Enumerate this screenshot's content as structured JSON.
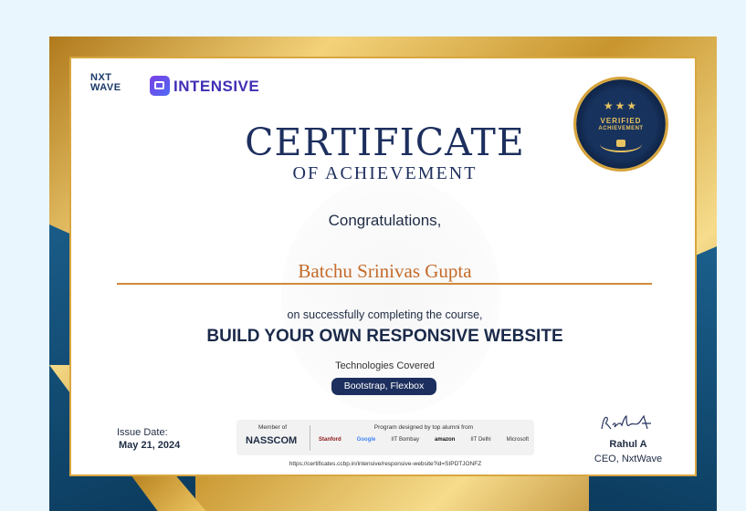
{
  "brand": {
    "nxtwave_line1": "NXT",
    "nxtwave_line2": "WAVE",
    "program": "INTENSIVE"
  },
  "seal": {
    "stars": "★★★",
    "line1": "VERIFIED",
    "line2": "ACHIEVEMENT"
  },
  "certificate": {
    "title": "CERTIFICATE",
    "subtitle": "OF ACHIEVEMENT",
    "congrats": "Congratulations,",
    "recipient": "Batchu Srinivas Gupta",
    "course_intro": "on successfully completing the course,",
    "course_name": "BUILD YOUR OWN RESPONSIVE WEBSITE",
    "tech_label": "Technologies Covered",
    "tech_value": "Bootstrap, Flexbox"
  },
  "issue": {
    "label": "Issue Date:",
    "date": "May 21, 2024"
  },
  "partners": {
    "member_of": "Member of",
    "nasscom": "NASSCOM",
    "program_text": "Program designed by top alumni from",
    "list": [
      "Stanford",
      "Google",
      "IIT Bombay",
      "amazon",
      "IIT Delhi",
      "Microsoft"
    ]
  },
  "verify_url": "https://certificates.ccbp.in/intensive/responsive-website?id=SIPDTJONFZ",
  "signatory": {
    "name": "Rahul A",
    "role": "CEO, NxtWave"
  },
  "colors": {
    "navy": "#1d2f5e",
    "gold": "#d6a43a",
    "recipient": "#c46a2a"
  }
}
